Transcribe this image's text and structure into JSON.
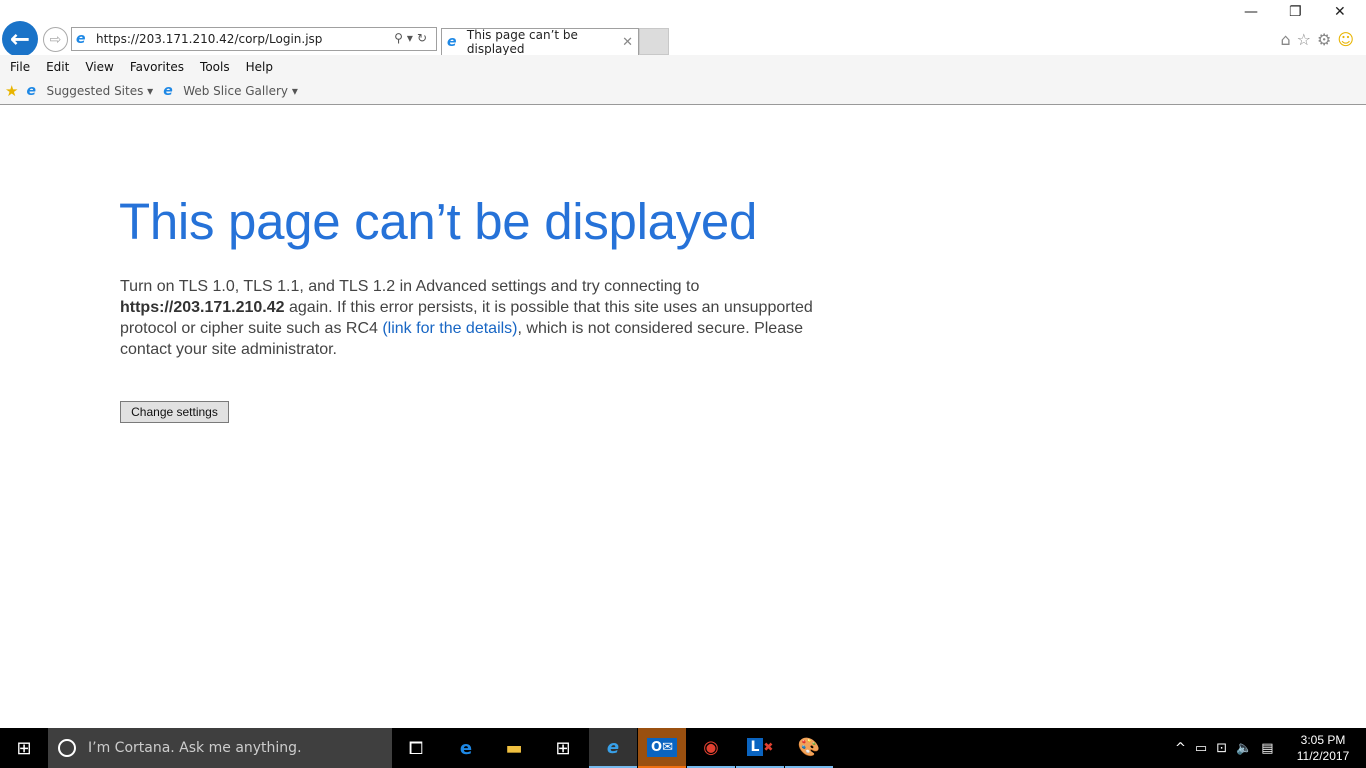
{
  "browser": {
    "url": "https://203.171.210.42/corp/Login.jsp",
    "tab_title": "This page can’t be displayed",
    "menu": [
      "File",
      "Edit",
      "View",
      "Favorites",
      "Tools",
      "Help"
    ],
    "favorites": [
      "Suggested Sites",
      "Web Slice Gallery"
    ]
  },
  "page": {
    "title": "This page can’t be displayed",
    "msg_1": "Turn on TLS 1.0, TLS 1.1, and TLS 1.2 in Advanced settings and try connecting to ",
    "msg_host": "https://203.171.210.42",
    "msg_2": " again. If this error persists, it is possible that this site uses an unsupported protocol or cipher suite such as RC4 ",
    "msg_link": "(link for the details)",
    "msg_3": ", which is not considered secure. Please contact your site administrator.",
    "button": "Change settings"
  },
  "taskbar": {
    "search_placeholder": "I’m Cortana. Ask me anything.",
    "time": "3:05 PM",
    "date": "11/2/2017",
    "apps": [
      "task-view",
      "edge",
      "file-explorer",
      "store",
      "internet-explorer",
      "outlook",
      "chrome",
      "lync",
      "paint"
    ]
  },
  "colors": {
    "title": "#2672d8",
    "link": "#1866c4",
    "back_button": "#1a73c8",
    "outlook_active": "#9a5010"
  }
}
